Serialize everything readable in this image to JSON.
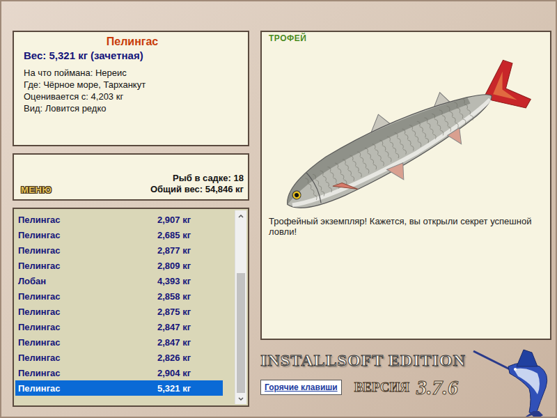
{
  "fish_info": {
    "name": "Пелингас",
    "weight": "Вес: 5,321 кг (зачетная)",
    "lines": [
      "На что поймана: Нереис",
      "Где: Чёрное море, Тарханкут",
      "Оценивается с: 4,203 кг",
      "Вид: Ловится редко"
    ]
  },
  "menu_button": "МЕНЮ",
  "keepnet": {
    "count": "Рыб в садке: 18",
    "total": "Общий вес: 54,846 кг"
  },
  "catch_list": {
    "rows": [
      {
        "name": "Пелингас",
        "weight": "2,907 кг",
        "selected": false
      },
      {
        "name": "Пелингас",
        "weight": "2,685 кг",
        "selected": false
      },
      {
        "name": "Пелингас",
        "weight": "2,877 кг",
        "selected": false
      },
      {
        "name": "Пелингас",
        "weight": "2,809 кг",
        "selected": false
      },
      {
        "name": "Лобан",
        "weight": "4,393 кг",
        "selected": false
      },
      {
        "name": "Пелингас",
        "weight": "2,858 кг",
        "selected": false
      },
      {
        "name": "Пелингас",
        "weight": "2,875 кг",
        "selected": false
      },
      {
        "name": "Пелингас",
        "weight": "2,847 кг",
        "selected": false
      },
      {
        "name": "Пелингас",
        "weight": "2,847 кг",
        "selected": false
      },
      {
        "name": "Пелингас",
        "weight": "2,826 кг",
        "selected": false
      },
      {
        "name": "Пелингас",
        "weight": "2,904 кг",
        "selected": false
      },
      {
        "name": "Пелингас",
        "weight": "5,321 кг",
        "selected": true
      }
    ],
    "scrollbar": {
      "thumb_share": 0.7,
      "position": 1
    }
  },
  "trophy": {
    "label": "ТРОФЕЙ",
    "caption": "Трофейный экземпляр! Кажется, вы открыли секрет успешной ловли!"
  },
  "logo": {
    "edition": "INSTALLSOFT EDITION",
    "version_label": "ВЕРСИЯ",
    "version": "3.7.6"
  },
  "hotkeys_button": "Горячие клавиши"
}
